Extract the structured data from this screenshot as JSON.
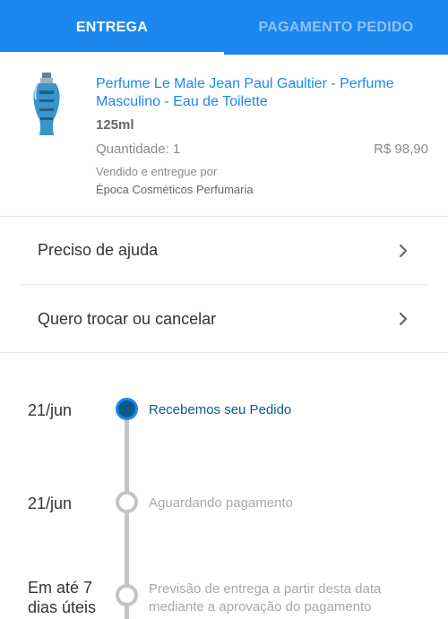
{
  "tabs": [
    {
      "label": "ENTREGA",
      "active": true
    },
    {
      "label": "PAGAMENTO PEDIDO",
      "active": false
    }
  ],
  "product": {
    "image_icon": "perfume-bottle-icon",
    "title": "Perfume Le Male Jean Paul Gaultier - Perfume Masculino - Eau de Toilette",
    "size": "125ml",
    "quantity": "Quantidade: 1",
    "price": "R$ 98,90",
    "seller_label": "Vendido e entregue por",
    "seller_name": "Época Cosméticos Perfumaria"
  },
  "actions": [
    {
      "label": "Preciso de ajuda",
      "icon": "chevron-right-icon"
    },
    {
      "label": "Quero trocar ou cancelar",
      "icon": "chevron-right-icon"
    }
  ],
  "timeline": [
    {
      "date": "21/jun",
      "text": "Recebemos seu Pedido",
      "status": "done"
    },
    {
      "date": "21/jun",
      "text": "Aguardando pagamento",
      "status": "pending"
    },
    {
      "date": "Em até 7 dias úteis",
      "text": "Previsão de entrega a partir desta data mediante a aprovação do pagamento",
      "status": "pending"
    }
  ],
  "colors": {
    "primary": "#1c87f0",
    "timeline_done": "#0c5a8c",
    "timeline_pending": "#c4c4c4"
  }
}
